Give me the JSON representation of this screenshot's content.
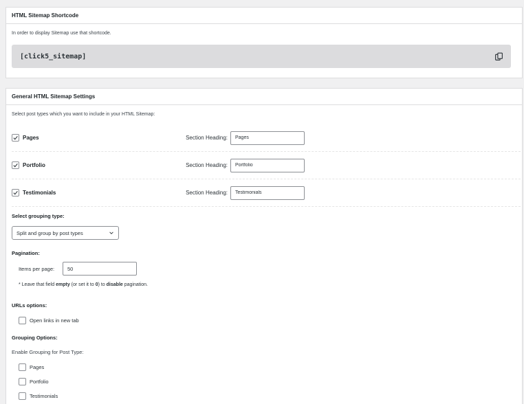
{
  "shortcode_panel": {
    "title": "HTML Sitemap Shortcode",
    "description": "In order to display Sitemap use that shortcode.",
    "shortcode": "[click5_sitemap]",
    "copy_icon": "copy-icon"
  },
  "settings_panel": {
    "title": "General HTML Sitemap Settings",
    "description": "Select post types which you want to include in your HTML Sitemap:",
    "post_types": [
      {
        "label": "Pages",
        "checked": true,
        "heading_label": "Section Heading:",
        "heading_value": "Pages"
      },
      {
        "label": "Portfolio",
        "checked": true,
        "heading_label": "Section Heading:",
        "heading_value": "Portfolio"
      },
      {
        "label": "Testimonials",
        "checked": true,
        "heading_label": "Section Heading:",
        "heading_value": "Testimonials"
      }
    ],
    "grouping_type": {
      "label": "Select grouping type:",
      "selected": "Split and group by post types"
    },
    "pagination": {
      "label": "Pagination:",
      "items_label": "Items per page:",
      "items_value": "50",
      "note_prefix": "* Leave that field ",
      "note_empty": "empty",
      "note_middle": " (or set it to ",
      "note_zero": "0",
      "note_to": ") to ",
      "note_disable": "disable",
      "note_suffix": " pagination."
    },
    "urls_options": {
      "label": "URLs options:",
      "open_new_tab": "Open links in new tab"
    },
    "grouping_options": {
      "label": "Grouping Options:",
      "enable_label": "Enable Grouping for Post Type:",
      "items": [
        "Pages",
        "Portfolio",
        "Testimonials"
      ]
    }
  }
}
